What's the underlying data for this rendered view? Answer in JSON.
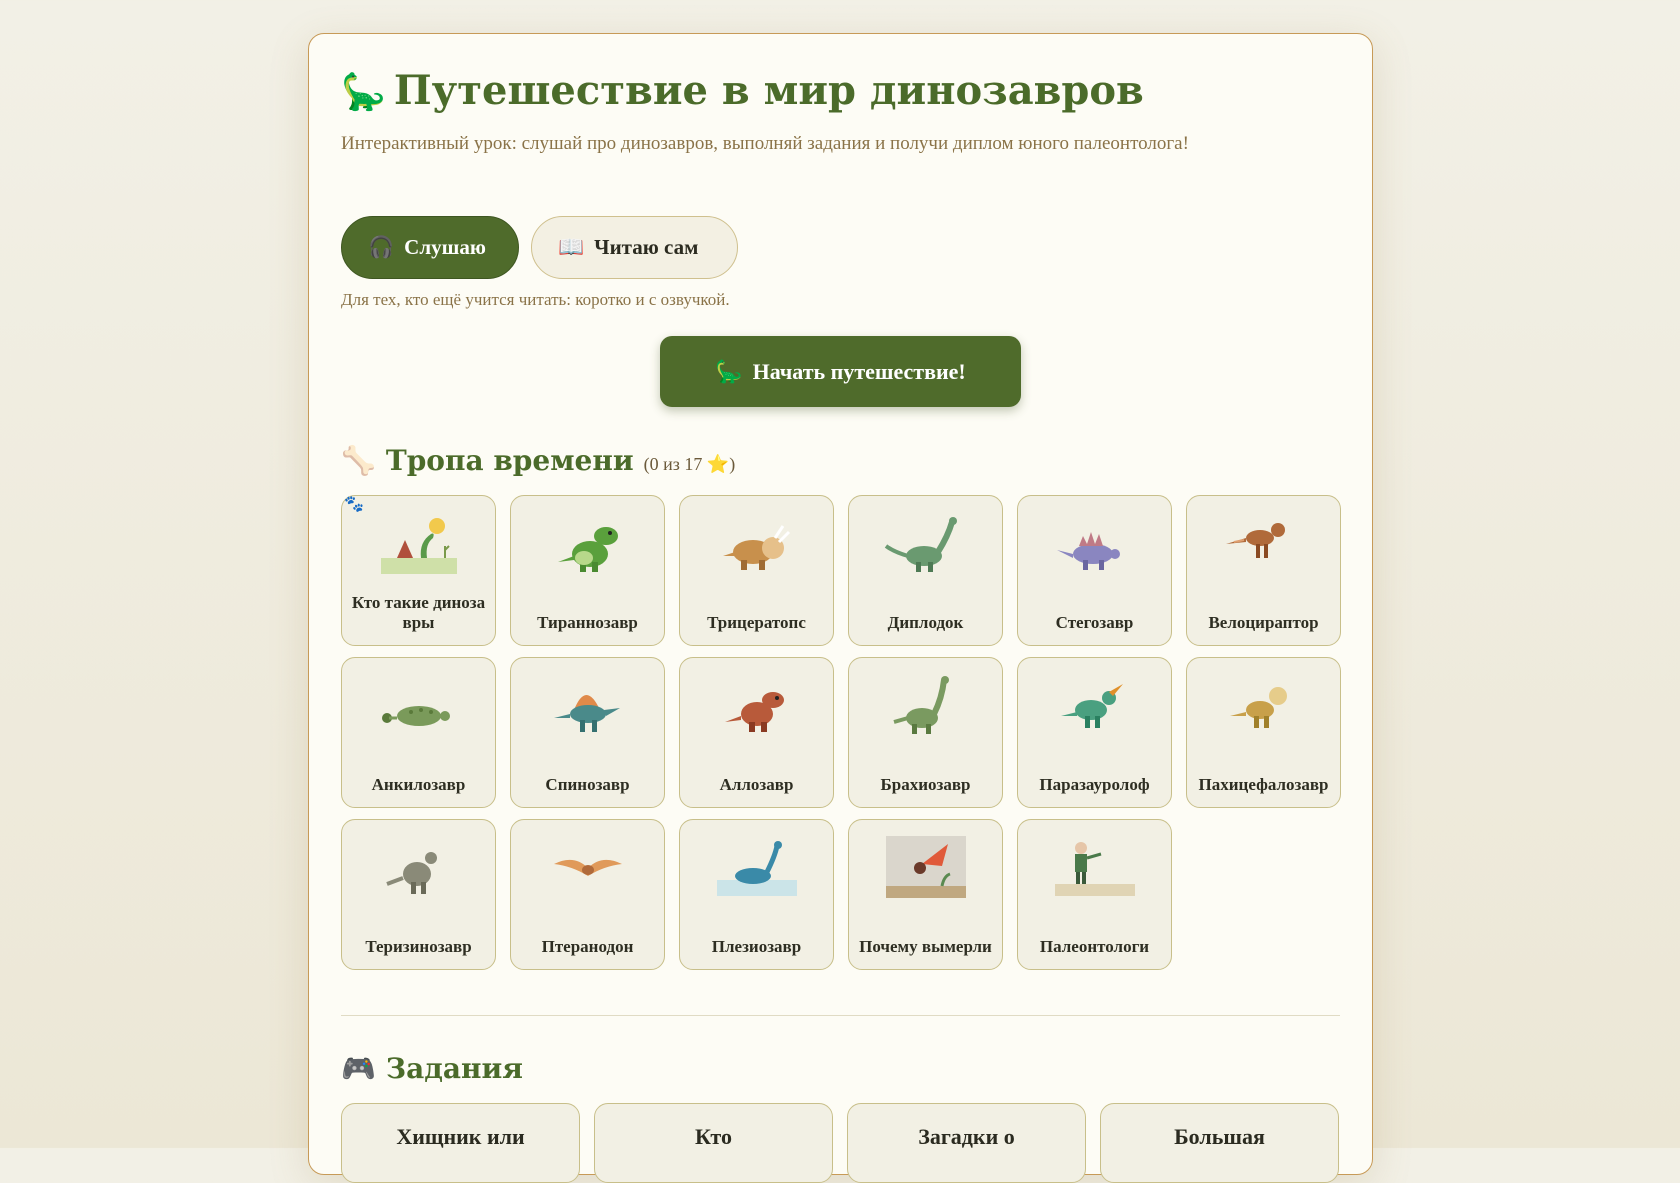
{
  "header": {
    "emoji": "🦕",
    "title": "Путешествие в мир динозавров",
    "subtitle": "Интерактивный урок: слушай про динозавров, выполняй задания и получи диплом юного палеонтолога!"
  },
  "modes": {
    "listen": {
      "icon": "🎧",
      "label": "Слушаю",
      "active": true
    },
    "read": {
      "icon": "📖",
      "label": "Читаю сам",
      "active": false
    },
    "hint": "Для тех, кто ещё учится читать: коротко и с озвучкой."
  },
  "start": {
    "icon": "🦕",
    "label": "Начать путешествие!"
  },
  "trail": {
    "icon": "🦴",
    "title": "Тропа времени",
    "count": "(0 из 17 ⭐)",
    "current_marker": "🐾",
    "items": [
      {
        "label": "Кто такие динозавры",
        "pic": "intro"
      },
      {
        "label": "Тираннозавр",
        "pic": "trex"
      },
      {
        "label": "Трицератопс",
        "pic": "tricera"
      },
      {
        "label": "Диплодок",
        "pic": "diplo"
      },
      {
        "label": "Стегозавр",
        "pic": "stego"
      },
      {
        "label": "Велоцираптор",
        "pic": "raptor"
      },
      {
        "label": "Анкилозавр",
        "pic": "ankylo"
      },
      {
        "label": "Спинозавр",
        "pic": "spino"
      },
      {
        "label": "Аллозавр",
        "pic": "allo"
      },
      {
        "label": "Брахиозавр",
        "pic": "brachio"
      },
      {
        "label": "Паразауролоф",
        "pic": "parasaur"
      },
      {
        "label": "Пахицефалозавр",
        "pic": "pachy"
      },
      {
        "label": "Теризинозавр",
        "pic": "therizino"
      },
      {
        "label": "Птеранодон",
        "pic": "ptera"
      },
      {
        "label": "Плезиозавр",
        "pic": "plesio"
      },
      {
        "label": "Почему вымерли",
        "pic": "meteor"
      },
      {
        "label": "Палеонтологи",
        "pic": "paleo"
      }
    ]
  },
  "tasks": {
    "icon": "🎮",
    "title": "Задания",
    "items": [
      "Хищник или",
      "Кто",
      "Загадки о",
      "Большая"
    ]
  }
}
